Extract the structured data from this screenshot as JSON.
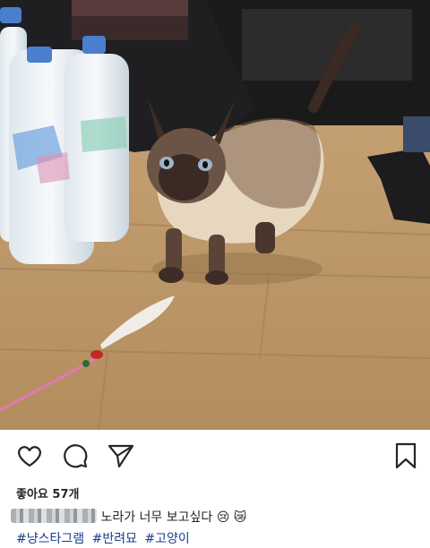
{
  "post": {
    "likes_text": "좋아요 57개",
    "caption": {
      "author_redacted": "",
      "text": "노라가 너무 보고싶다",
      "emojis": [
        "😢",
        "😿"
      ]
    },
    "hashtags": [
      "#냥스타그램",
      "#반려묘",
      "#고양이"
    ]
  },
  "icons": {
    "like": "heart-icon",
    "comment": "comment-icon",
    "share": "send-icon",
    "save": "bookmark-icon"
  },
  "colors": {
    "hashtag": "#1b3f8b",
    "text": "#262626",
    "background": "#ffffff"
  }
}
